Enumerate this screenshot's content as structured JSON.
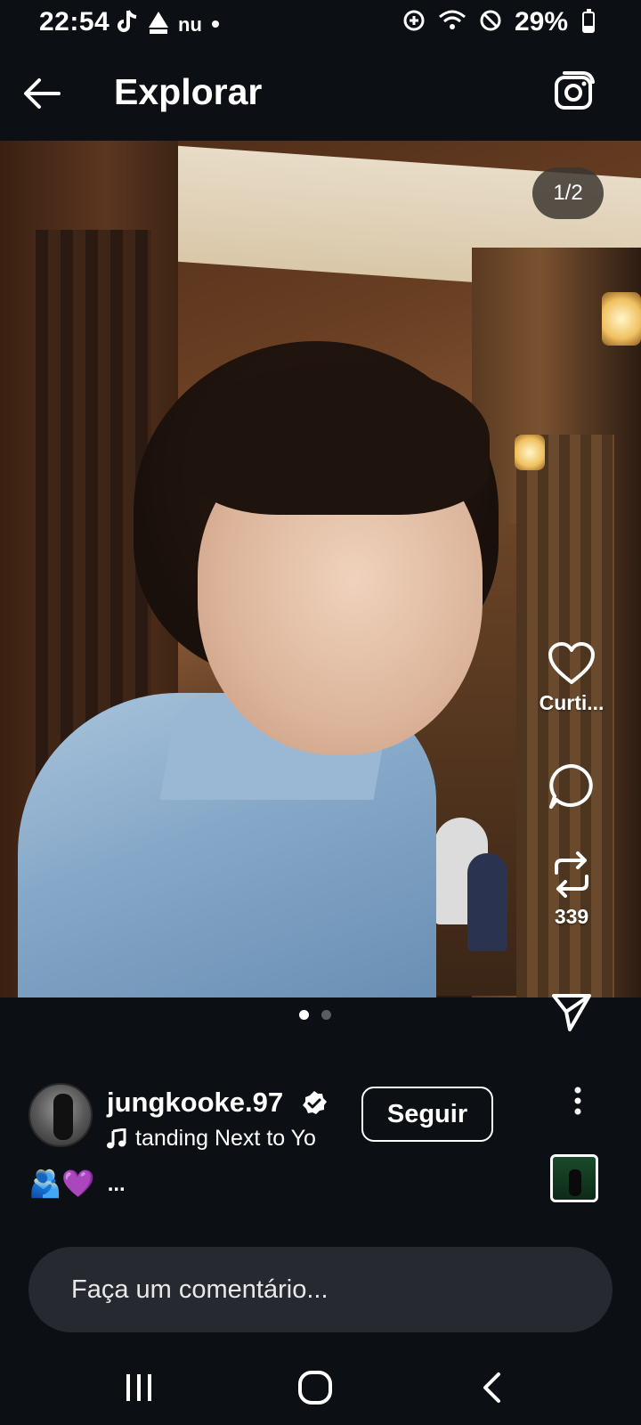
{
  "status_bar": {
    "time": "22:54",
    "left_icons": [
      "tiktok-icon",
      "warning-icon",
      "nubank-icon",
      "dot-icon"
    ],
    "right_icons": [
      "data-saver-icon",
      "wifi-icon",
      "do-not-disturb-icon",
      "battery-icon"
    ],
    "battery_percent": "29%",
    "battery_level": 0.29,
    "nubank_text": "nu"
  },
  "header": {
    "title": "Explorar",
    "back_icon": "arrow-left-icon",
    "camera_icon": "camera-icon"
  },
  "post": {
    "media_counter": "1/2",
    "carousel": {
      "total": 2,
      "active_index": 0
    },
    "actions": {
      "like_label": "Curti...",
      "comment_icon": "comment-icon",
      "repost_count": "339",
      "share_icon": "send-icon"
    },
    "author": {
      "username": "jungkooke.97",
      "verified": true,
      "music_text": "tanding Next to Yo",
      "follow_label": "Seguir"
    },
    "caption": {
      "emojis": "🫂💜",
      "more": "..."
    }
  },
  "comment": {
    "placeholder": "Faça um comentário..."
  },
  "nav_bar": {
    "buttons": [
      "recent-apps-icon",
      "home-icon",
      "back-icon"
    ]
  },
  "colors": {
    "background": "#0c1014",
    "comment_box": "#262a30",
    "text": "#ffffff"
  }
}
